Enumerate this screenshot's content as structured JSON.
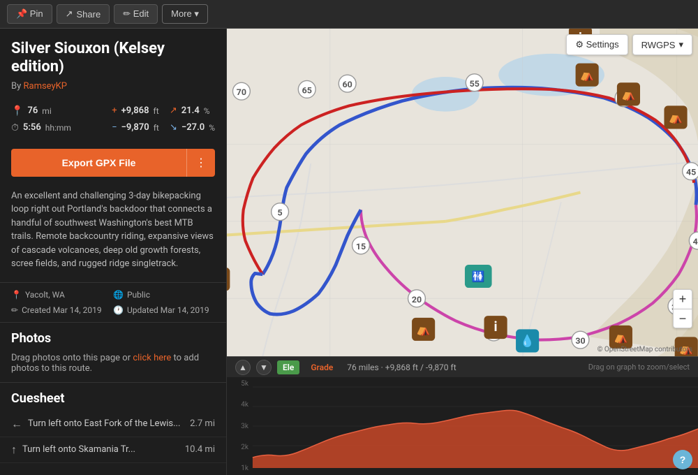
{
  "topbar": {
    "pin_label": "📌 Pin",
    "share_label": "Share",
    "edit_label": "✏ Edit",
    "more_label": "More ▾"
  },
  "route": {
    "title": "Silver Siouxon (Kelsey edition)",
    "author": "RamseyKP",
    "stats": {
      "distance": "76",
      "distance_unit": "mi",
      "elevation_gain": "+9,868",
      "elevation_unit": "ft",
      "climb_percent": "21.4",
      "time": "5:56",
      "time_unit": "hh:mm",
      "elevation_loss": "−9,870",
      "descent_percent": "−27.0"
    },
    "export_label": "Export GPX File",
    "description": "An excellent and challenging 3-day bikepacking loop right out Portland's backdoor that connects a handful of southwest Washington's best MTB trails. Remote backcountry riding, expansive views of cascade volcanoes, deep old growth forests, scree fields, and rugged ridge singletrack.",
    "location": "Yacolt, WA",
    "privacy": "Public",
    "created": "Created Mar 14, 2019",
    "updated": "Updated Mar 14, 2019"
  },
  "photos": {
    "section_title": "Photos",
    "drag_text": "Drag photos onto this page or ",
    "link_text": "click here",
    "after_text": " to add photos to this route."
  },
  "cuesheet": {
    "section_title": "Cuesheet",
    "items": [
      {
        "direction": "←",
        "text": "Turn left onto East Fork of the Lewis...",
        "distance": "2.7 mi"
      },
      {
        "direction": "↑",
        "text": "Turn left onto Skamania Tr...",
        "distance": "10.4 mi"
      }
    ]
  },
  "map": {
    "settings_label": "⚙ Settings",
    "rwgps_label": "RWGPS",
    "attribution": "© OpenStreetMap contributors",
    "zoom_in": "+",
    "zoom_out": "−"
  },
  "elevation": {
    "nav_up": "▲",
    "nav_down": "▼",
    "ele_label": "Ele",
    "grade_label": "Grade",
    "stats": "76 miles · +9,868 ft / -9,870 ft",
    "drag_hint": "Drag on graph to zoom/select",
    "y_labels": [
      "5k",
      "4k",
      "3k",
      "2k",
      "1k"
    ]
  }
}
